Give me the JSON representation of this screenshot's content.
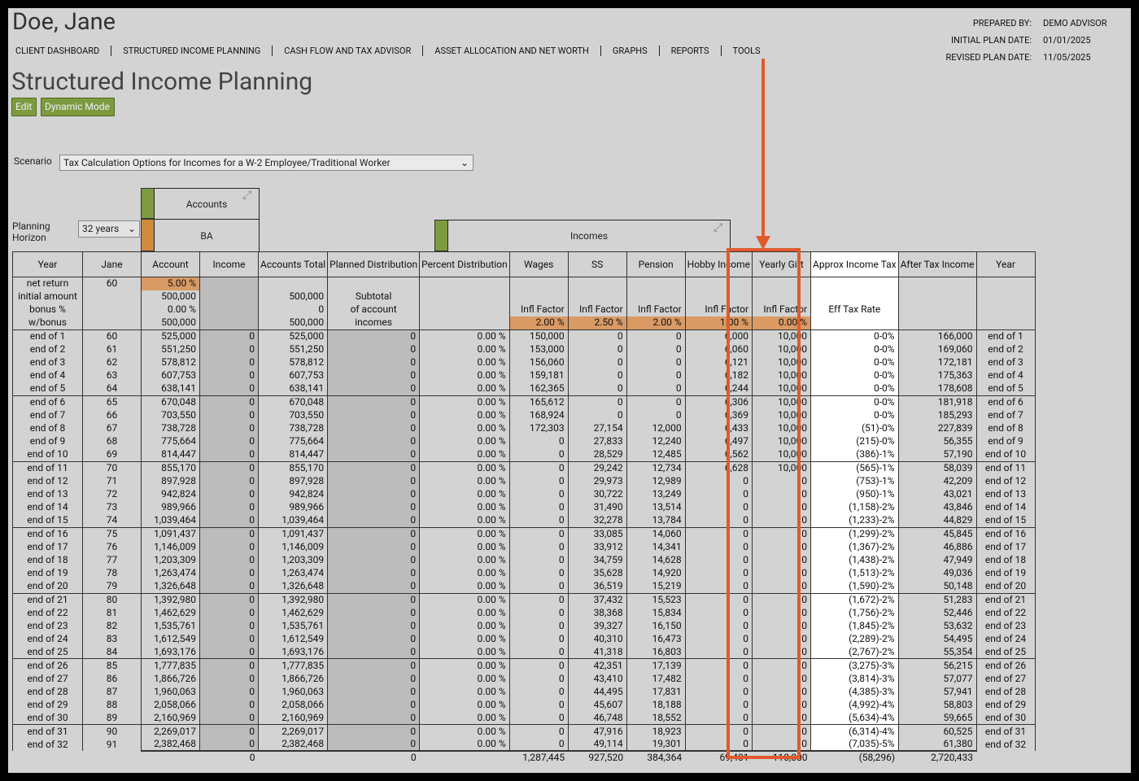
{
  "client": {
    "name": "Doe, Jane"
  },
  "nav": [
    "CLIENT DASHBOARD",
    "STRUCTURED INCOME PLANNING",
    "CASH FLOW AND TAX ADVISOR",
    "ASSET ALLOCATION AND NET WORTH",
    "GRAPHS",
    "REPORTS",
    "TOOLS"
  ],
  "meta": {
    "prepared_by_label": "PREPARED BY:",
    "prepared_by": "DEMO ADVISOR",
    "initial_label": "INITIAL PLAN DATE:",
    "initial_date": "01/01/2025",
    "revised_label": "REVISED PLAN DATE:",
    "revised_date": "11/05/2025"
  },
  "page": {
    "title": "Structured Income Planning",
    "edit": "Edit",
    "dynamic": "Dynamic Mode"
  },
  "scenario": {
    "label": "Scenario",
    "value": "Tax Calculation Options for Incomes for a W-2 Employee/Traditional Worker"
  },
  "horizon": {
    "label1": "Planning",
    "label2": "Horizon",
    "value": "32 years"
  },
  "groups": {
    "accounts": "Accounts",
    "ba": "BA",
    "incomes": "Incomes"
  },
  "headers": [
    "Year",
    "Jane",
    "Account",
    "Income",
    "Accounts Total",
    "Planned Distribution",
    "Percent Distribution",
    "Wages",
    "SS",
    "Pension",
    "Hobby Income",
    "Yearly Gift",
    "Approx Income Tax",
    "After Tax Income",
    "Year"
  ],
  "params": {
    "labels": [
      "net return",
      "initial amount",
      "bonus %",
      "w/bonus"
    ],
    "age": "60",
    "net_return": "5.00  %",
    "initial": "500,000",
    "bonus": "0.00  %",
    "wbonus": "500,000",
    "tot_initial": "500,000",
    "tot_bonus": "0",
    "tot_wbonus": "500,000",
    "subtotal": [
      "Subtotal",
      "of account",
      "incomes"
    ],
    "infl_label": "Infl Factor",
    "infl": [
      "2.00  %",
      "2.50  %",
      "2.00  %",
      "1.00  %",
      "0.00  %"
    ],
    "eff_tax": "Eff Tax Rate"
  },
  "pct_suffix": "0.00  %",
  "rows": [
    [
      "end of 1",
      "60",
      "525,000",
      "0",
      "525,000",
      "0",
      "150,000",
      "0",
      "0",
      "6,000",
      "10,000",
      "0-0%",
      "166,000"
    ],
    [
      "end of 2",
      "61",
      "551,250",
      "0",
      "551,250",
      "0",
      "153,000",
      "0",
      "0",
      "6,060",
      "10,000",
      "0-0%",
      "169,060"
    ],
    [
      "end of 3",
      "62",
      "578,812",
      "0",
      "578,812",
      "0",
      "156,060",
      "0",
      "0",
      "6,121",
      "10,000",
      "0-0%",
      "172,181"
    ],
    [
      "end of 4",
      "63",
      "607,753",
      "0",
      "607,753",
      "0",
      "159,181",
      "0",
      "0",
      "6,182",
      "10,000",
      "0-0%",
      "175,363"
    ],
    [
      "end of 5",
      "64",
      "638,141",
      "0",
      "638,141",
      "0",
      "162,365",
      "0",
      "0",
      "6,244",
      "10,000",
      "0-0%",
      "178,608"
    ],
    [
      "end of 6",
      "65",
      "670,048",
      "0",
      "670,048",
      "0",
      "165,612",
      "0",
      "0",
      "6,306",
      "10,000",
      "0-0%",
      "181,918"
    ],
    [
      "end of 7",
      "66",
      "703,550",
      "0",
      "703,550",
      "0",
      "168,924",
      "0",
      "0",
      "6,369",
      "10,000",
      "0-0%",
      "185,293"
    ],
    [
      "end of 8",
      "67",
      "738,728",
      "0",
      "738,728",
      "0",
      "172,303",
      "27,154",
      "12,000",
      "6,433",
      "10,000",
      "(51)-0%",
      "227,839"
    ],
    [
      "end of 9",
      "68",
      "775,664",
      "0",
      "775,664",
      "0",
      "0",
      "27,833",
      "12,240",
      "6,497",
      "10,000",
      "(215)-0%",
      "56,355"
    ],
    [
      "end of 10",
      "69",
      "814,447",
      "0",
      "814,447",
      "0",
      "0",
      "28,529",
      "12,485",
      "6,562",
      "10,000",
      "(386)-1%",
      "57,190"
    ],
    [
      "end of 11",
      "70",
      "855,170",
      "0",
      "855,170",
      "0",
      "0",
      "29,242",
      "12,734",
      "6,628",
      "10,000",
      "(565)-1%",
      "58,039"
    ],
    [
      "end of 12",
      "71",
      "897,928",
      "0",
      "897,928",
      "0",
      "0",
      "29,973",
      "12,989",
      "0",
      "0",
      "(753)-1%",
      "42,209"
    ],
    [
      "end of 13",
      "72",
      "942,824",
      "0",
      "942,824",
      "0",
      "0",
      "30,722",
      "13,249",
      "0",
      "0",
      "(950)-1%",
      "43,021"
    ],
    [
      "end of 14",
      "73",
      "989,966",
      "0",
      "989,966",
      "0",
      "0",
      "31,490",
      "13,514",
      "0",
      "0",
      "(1,158)-2%",
      "43,846"
    ],
    [
      "end of 15",
      "74",
      "1,039,464",
      "0",
      "1,039,464",
      "0",
      "0",
      "32,278",
      "13,784",
      "0",
      "0",
      "(1,233)-2%",
      "44,829"
    ],
    [
      "end of 16",
      "75",
      "1,091,437",
      "0",
      "1,091,437",
      "0",
      "0",
      "33,085",
      "14,060",
      "0",
      "0",
      "(1,299)-2%",
      "45,845"
    ],
    [
      "end of 17",
      "76",
      "1,146,009",
      "0",
      "1,146,009",
      "0",
      "0",
      "33,912",
      "14,341",
      "0",
      "0",
      "(1,367)-2%",
      "46,886"
    ],
    [
      "end of 18",
      "77",
      "1,203,309",
      "0",
      "1,203,309",
      "0",
      "0",
      "34,759",
      "14,628",
      "0",
      "0",
      "(1,438)-2%",
      "47,949"
    ],
    [
      "end of 19",
      "78",
      "1,263,474",
      "0",
      "1,263,474",
      "0",
      "0",
      "35,628",
      "14,920",
      "0",
      "0",
      "(1,513)-2%",
      "49,036"
    ],
    [
      "end of 20",
      "79",
      "1,326,648",
      "0",
      "1,326,648",
      "0",
      "0",
      "36,519",
      "15,219",
      "0",
      "0",
      "(1,590)-2%",
      "50,148"
    ],
    [
      "end of 21",
      "80",
      "1,392,980",
      "0",
      "1,392,980",
      "0",
      "0",
      "37,432",
      "15,523",
      "0",
      "0",
      "(1,672)-2%",
      "51,283"
    ],
    [
      "end of 22",
      "81",
      "1,462,629",
      "0",
      "1,462,629",
      "0",
      "0",
      "38,368",
      "15,834",
      "0",
      "0",
      "(1,756)-2%",
      "52,446"
    ],
    [
      "end of 23",
      "82",
      "1,535,761",
      "0",
      "1,535,761",
      "0",
      "0",
      "39,327",
      "16,150",
      "0",
      "0",
      "(1,845)-2%",
      "53,632"
    ],
    [
      "end of 24",
      "83",
      "1,612,549",
      "0",
      "1,612,549",
      "0",
      "0",
      "40,310",
      "16,473",
      "0",
      "0",
      "(2,289)-2%",
      "54,495"
    ],
    [
      "end of 25",
      "84",
      "1,693,176",
      "0",
      "1,693,176",
      "0",
      "0",
      "41,318",
      "16,803",
      "0",
      "0",
      "(2,767)-2%",
      "55,354"
    ],
    [
      "end of 26",
      "85",
      "1,777,835",
      "0",
      "1,777,835",
      "0",
      "0",
      "42,351",
      "17,139",
      "0",
      "0",
      "(3,275)-3%",
      "56,215"
    ],
    [
      "end of 27",
      "86",
      "1,866,726",
      "0",
      "1,866,726",
      "0",
      "0",
      "43,410",
      "17,482",
      "0",
      "0",
      "(3,814)-3%",
      "57,077"
    ],
    [
      "end of 28",
      "87",
      "1,960,063",
      "0",
      "1,960,063",
      "0",
      "0",
      "44,495",
      "17,831",
      "0",
      "0",
      "(4,385)-3%",
      "57,941"
    ],
    [
      "end of 29",
      "88",
      "2,058,066",
      "0",
      "2,058,066",
      "0",
      "0",
      "45,607",
      "18,188",
      "0",
      "0",
      "(4,992)-4%",
      "58,803"
    ],
    [
      "end of 30",
      "89",
      "2,160,969",
      "0",
      "2,160,969",
      "0",
      "0",
      "46,748",
      "18,552",
      "0",
      "0",
      "(5,634)-4%",
      "59,665"
    ],
    [
      "end of 31",
      "90",
      "2,269,017",
      "0",
      "2,269,017",
      "0",
      "0",
      "47,916",
      "18,923",
      "0",
      "0",
      "(6,314)-4%",
      "60,525"
    ],
    [
      "end of 32",
      "91",
      "2,382,468",
      "0",
      "2,382,468",
      "0",
      "0",
      "49,114",
      "19,301",
      "0",
      "0",
      "(7,035)-5%",
      "61,380"
    ]
  ],
  "totals": {
    "income": "0",
    "planned": "0",
    "wages": "1,287,445",
    "ss": "927,520",
    "pension": "384,364",
    "hobby": "69,401",
    "gift": "110,000",
    "tax": "(58,296)",
    "after_tax": "2,720,433"
  },
  "colors": {
    "background": "#d3d3d3",
    "accent_green": "#7d9b3e",
    "accent_orange": "#d99a64",
    "highlight": "#e05a2b"
  }
}
